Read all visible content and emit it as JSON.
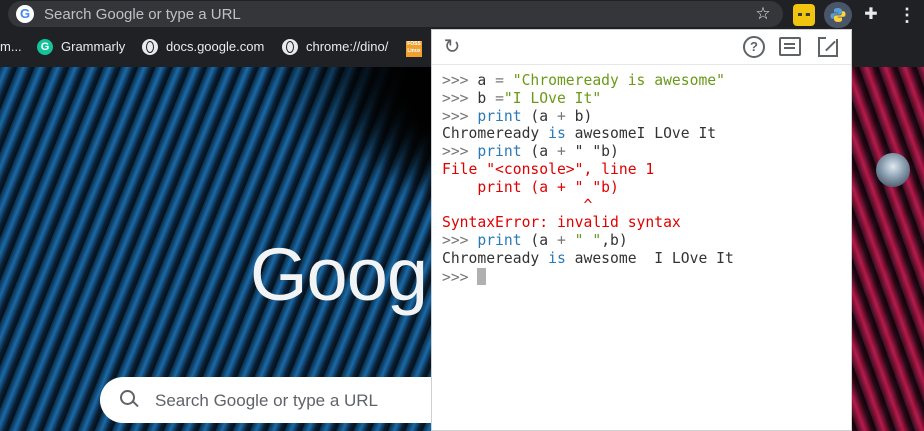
{
  "omnibox": {
    "placeholder": "Search Google or type a URL"
  },
  "bookmarks": [
    {
      "label": "m..."
    },
    {
      "label": "Grammarly"
    },
    {
      "label": "docs.google.com"
    },
    {
      "label": "chrome://dino/"
    }
  ],
  "newtab": {
    "logo_text": "Goog",
    "search_placeholder": "Search Google or type a URL"
  },
  "console": {
    "lines": [
      [
        {
          "t": ">>> ",
          "c": "prompt"
        },
        {
          "t": "a ",
          "c": ""
        },
        {
          "t": "=",
          "c": "op"
        },
        {
          "t": " \"Chromeready is awesome\"",
          "c": "str"
        }
      ],
      [
        {
          "t": ">>> ",
          "c": "prompt"
        },
        {
          "t": "b ",
          "c": ""
        },
        {
          "t": "=",
          "c": "op"
        },
        {
          "t": "\"I LOve It\"",
          "c": "str"
        }
      ],
      [
        {
          "t": ">>> ",
          "c": "prompt"
        },
        {
          "t": "print",
          "c": "kw"
        },
        {
          "t": " (a ",
          "c": ""
        },
        {
          "t": "+",
          "c": "op"
        },
        {
          "t": " b)",
          "c": ""
        }
      ],
      [
        {
          "t": "Chromeready ",
          "c": ""
        },
        {
          "t": "is",
          "c": "kw"
        },
        {
          "t": " awesomeI LOve It",
          "c": ""
        }
      ],
      [
        {
          "t": ">>> ",
          "c": "prompt"
        },
        {
          "t": "print",
          "c": "kw"
        },
        {
          "t": " (a ",
          "c": ""
        },
        {
          "t": "+",
          "c": "op"
        },
        {
          "t": " \" \"b)",
          "c": ""
        }
      ],
      [
        {
          "t": "File \"<console>\", line 1",
          "c": "err"
        }
      ],
      [
        {
          "t": "    print (a + \" \"b)",
          "c": "err"
        }
      ],
      [
        {
          "t": "                ^",
          "c": "err"
        }
      ],
      [
        {
          "t": "SyntaxError: invalid syntax",
          "c": "err"
        }
      ],
      [
        {
          "t": ">>> ",
          "c": "prompt"
        },
        {
          "t": "print",
          "c": "kw"
        },
        {
          "t": " (a ",
          "c": ""
        },
        {
          "t": "+",
          "c": "op"
        },
        {
          "t": " \" \"",
          "c": "str"
        },
        {
          "t": ",b)",
          "c": ""
        }
      ],
      [
        {
          "t": "Chromeready ",
          "c": ""
        },
        {
          "t": "is",
          "c": "kw"
        },
        {
          "t": " awesome  I LOve It",
          "c": ""
        }
      ],
      [
        {
          "t": ">>> ",
          "c": "prompt"
        },
        {
          "t": "",
          "c": "cursor"
        }
      ]
    ]
  },
  "colors": {
    "toolbar_bg": "#202124",
    "omnibox_bg": "#35363a",
    "string": "#6a9a18",
    "keyword": "#2a7ab8",
    "error": "#e00000"
  }
}
